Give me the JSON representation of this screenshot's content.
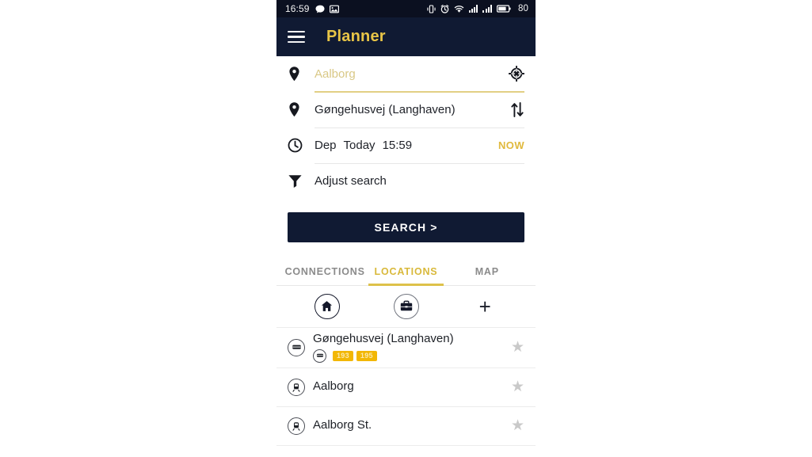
{
  "statusbar": {
    "time": "16:59",
    "left_icons": [
      "message-icon",
      "image-icon"
    ],
    "right_icons": [
      "vibrate-icon",
      "alarm-icon",
      "wifi-icon",
      "signal-sim1-icon",
      "signal-sim2-icon",
      "battery-icon"
    ],
    "battery_level": "80"
  },
  "appbar": {
    "menu_icon": "hamburger-menu-icon",
    "title": "Planner"
  },
  "search_form": {
    "origin": {
      "icon": "map-pin-icon",
      "value": "Aalborg",
      "is_placeholder": true,
      "action_icon": "gps-crosshair-icon"
    },
    "destination": {
      "icon": "map-pin-icon",
      "value": "Gøngehusvej (Langhaven)",
      "action_icon": "swap-arrows-icon"
    },
    "time": {
      "icon": "clock-icon",
      "mode": "Dep",
      "day": "Today",
      "clock": "15:59",
      "now_label": "NOW"
    },
    "adjust": {
      "icon": "filter-funnel-icon",
      "label": "Adjust search"
    },
    "search_button_label": "SEARCH >"
  },
  "tabs": [
    {
      "label": "CONNECTIONS",
      "active": false
    },
    {
      "label": "LOCATIONS",
      "active": true
    },
    {
      "label": "MAP",
      "active": false
    }
  ],
  "quick_actions": [
    {
      "name": "home-shortcut",
      "icon": "home-icon"
    },
    {
      "name": "work-shortcut",
      "icon": "briefcase-icon"
    },
    {
      "name": "add-shortcut",
      "icon": "plus-icon",
      "glyph": "+"
    }
  ],
  "locations": [
    {
      "name": "Gøngehusvej (Langhaven)",
      "icon": "bus-stop-icon",
      "lines": [
        "193",
        "195"
      ],
      "favorite_icon": "star-icon"
    },
    {
      "name": "Aalborg",
      "icon": "train-station-icon",
      "lines": [],
      "favorite_icon": "star-icon"
    },
    {
      "name": "Aalborg St.",
      "icon": "train-station-icon",
      "lines": [],
      "favorite_icon": "star-icon"
    }
  ],
  "colors": {
    "app_bar_bg": "#101a33",
    "status_bar_bg": "#0b1020",
    "accent_gold": "#e8c547",
    "tab_active": "#d9b93b",
    "placeholder_gold": "#d9c886",
    "badge_bg": "#f2b705",
    "badge_text": "#fbe9ad",
    "star_gray": "#c9c9c9",
    "text_primary": "#1d2026"
  },
  "star_glyph": "★"
}
